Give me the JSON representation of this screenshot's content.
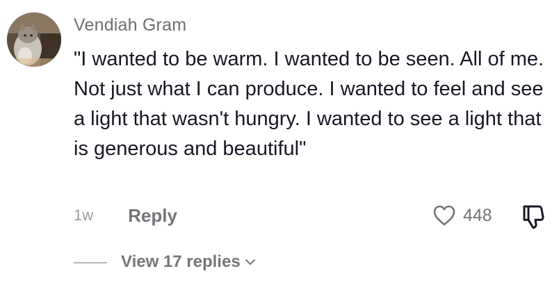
{
  "comment": {
    "author": "Vendiah Gram",
    "text": "\"I wanted to be warm. I wanted to be seen. All of me. Not just what I can produce. I wanted to feel and see a light that wasn't hungry. I wanted to see a light that is generous and beautiful\"",
    "time_ago": "1w",
    "reply_label": "Reply",
    "like_count": "448",
    "view_replies_label": "View 17 replies"
  },
  "icons": {
    "like": "heart-outline-icon",
    "dislike": "thumbs-down-icon",
    "expand": "chevron-down-icon"
  },
  "colors": {
    "text_primary": "#161823",
    "text_secondary": "#75757a"
  }
}
